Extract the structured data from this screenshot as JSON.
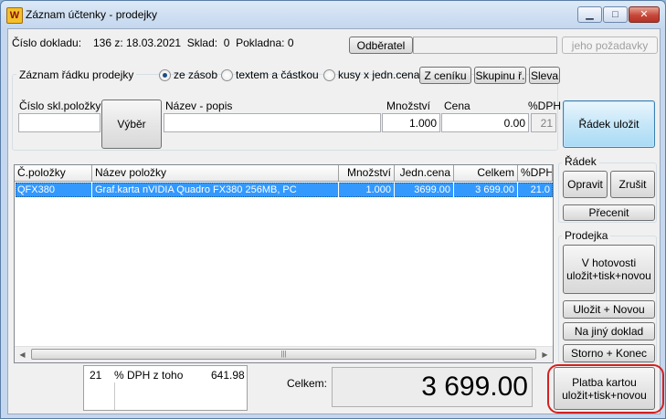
{
  "window": {
    "title": "Záznam účtenky - prodejky",
    "icon": "receipt-app-icon",
    "controls": {
      "minimize": "▁",
      "maximize": "□",
      "close": "✕"
    }
  },
  "header": {
    "doc_label": "Číslo dokladu:",
    "doc_value": "136 z: 18.03.2021  Sklad:  0  Pokladna: 0",
    "customer_button": "Odběratel",
    "customer_value": "",
    "requirements_button": "jeho požadavky"
  },
  "record": {
    "group_title": "Záznam řádku prodejky",
    "options": [
      {
        "label": "ze zásob",
        "selected": true
      },
      {
        "label": "textem a částkou",
        "selected": false
      },
      {
        "label": "kusy x jedn.cena",
        "selected": false
      }
    ],
    "buttons": {
      "price_list": "Z ceníku",
      "group": "Skupinu ř.",
      "discount": "Sleva"
    },
    "labels": {
      "item_no": "Číslo skl.položky",
      "name": "Název - popis",
      "quantity": "Množství",
      "price": "Cena",
      "vat": "%DPH"
    },
    "values": {
      "item_no": "",
      "name": "",
      "quantity": "1.000",
      "price": "0.00",
      "vat": "21"
    },
    "select_button": "Výběr",
    "save_row_button": "Řádek uložit"
  },
  "table": {
    "columns": [
      "Č.položky",
      "Název položky",
      "Množství",
      "Jedn.cena",
      "Celkem",
      "%DPH"
    ],
    "rows": [
      [
        "QFX380",
        "Graf.karta nVIDIA Quadro FX380 256MB, PC",
        "1.000",
        "3699.00",
        "3 699.00",
        "21.0"
      ]
    ]
  },
  "row_panel": {
    "title": "Řádek",
    "edit": "Opravit",
    "cancel": "Zrušit",
    "reprice": "Přecenit"
  },
  "sale_panel": {
    "title": "Prodejka",
    "cash": "V hotovosti\nuložit+tisk+novou",
    "save_new": "Uložit + Novou",
    "other_doc": "Na jiný doklad",
    "cancel_end": "Storno + Konec",
    "card": "Platba kartou\nuložit+tisk+novou"
  },
  "summary": {
    "vat_rate": "21",
    "vat_label": "% DPH z toho",
    "vat_amount": "641.98",
    "total_label": "Celkem:",
    "total_value": "3 699.00"
  },
  "colors": {
    "selection": "#3399ff",
    "highlight_border": "#d42020"
  }
}
